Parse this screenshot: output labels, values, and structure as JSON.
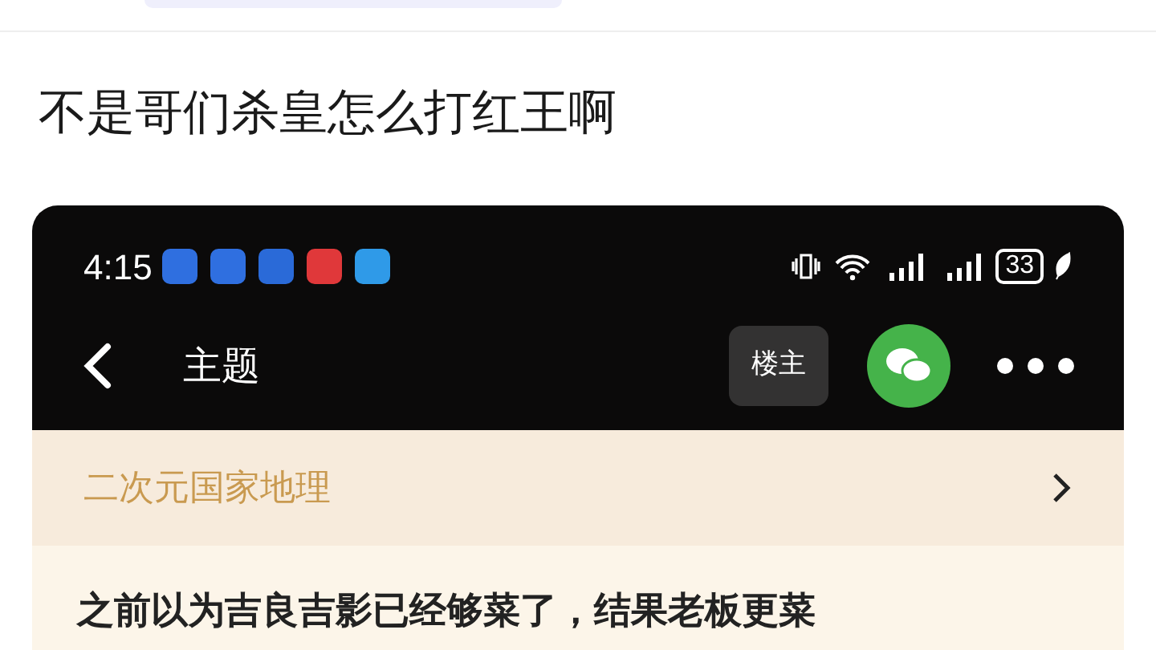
{
  "post": {
    "title": "不是哥们杀皇怎么打红王啊"
  },
  "screenshot": {
    "status_bar": {
      "time": "4:15",
      "app_icons": [
        {
          "color": "#2f6fe0"
        },
        {
          "color": "#2f6fe0"
        },
        {
          "color": "#2a6ad8"
        },
        {
          "color": "#e0383a"
        },
        {
          "color": "#2f9ae8"
        }
      ],
      "battery": "33"
    },
    "nav": {
      "title": "主题",
      "owner_button": "楼主"
    },
    "forum": {
      "name": "二次元国家地理"
    },
    "body": "之前以为吉良吉影已经够菜了，结果老板更菜"
  }
}
